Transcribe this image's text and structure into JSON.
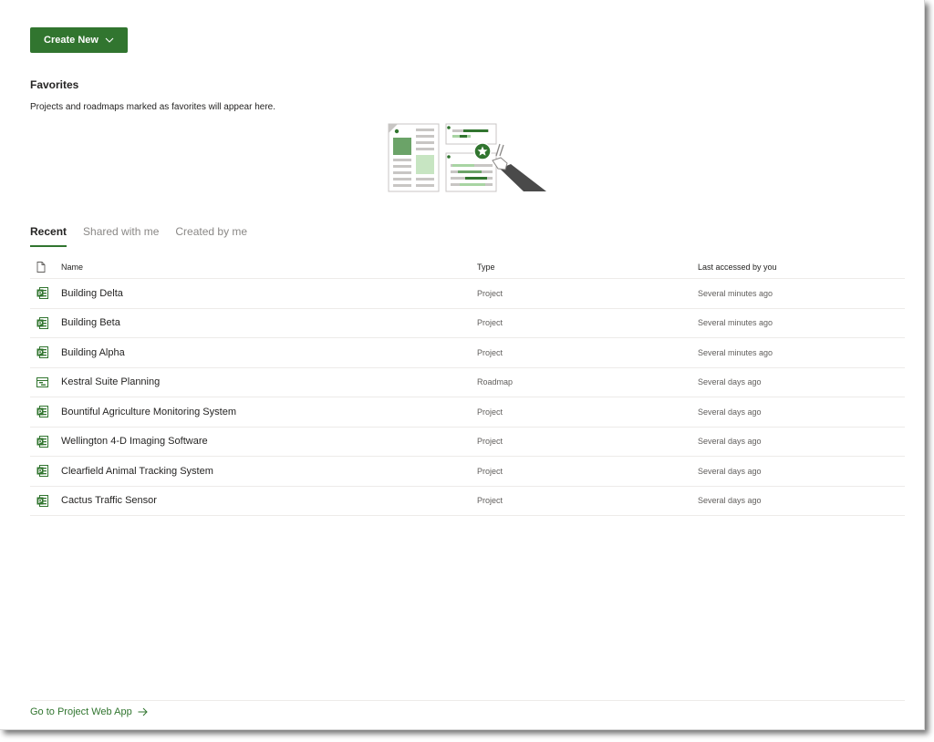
{
  "toolbar": {
    "create_new_label": "Create New"
  },
  "favorites": {
    "title": "Favorites",
    "description": "Projects and roadmaps marked as favorites will appear here."
  },
  "tabs": [
    {
      "label": "Recent",
      "active": true
    },
    {
      "label": "Shared with me",
      "active": false
    },
    {
      "label": "Created by me",
      "active": false
    }
  ],
  "table": {
    "headers": {
      "name": "Name",
      "type": "Type",
      "last_accessed": "Last accessed by you"
    },
    "rows": [
      {
        "icon": "project-icon",
        "name": "Building Delta",
        "type": "Project",
        "last_accessed": "Several minutes ago"
      },
      {
        "icon": "project-icon",
        "name": "Building Beta",
        "type": "Project",
        "last_accessed": "Several minutes ago"
      },
      {
        "icon": "project-icon",
        "name": "Building Alpha",
        "type": "Project",
        "last_accessed": "Several minutes ago"
      },
      {
        "icon": "roadmap-icon",
        "name": "Kestral Suite Planning",
        "type": "Roadmap",
        "last_accessed": "Several days ago"
      },
      {
        "icon": "project-icon",
        "name": "Bountiful Agriculture Monitoring System",
        "type": "Project",
        "last_accessed": "Several days ago"
      },
      {
        "icon": "project-icon",
        "name": "Wellington 4-D Imaging Software",
        "type": "Project",
        "last_accessed": "Several days ago"
      },
      {
        "icon": "project-icon",
        "name": "Clearfield Animal Tracking System",
        "type": "Project",
        "last_accessed": "Several days ago"
      },
      {
        "icon": "project-icon",
        "name": "Cactus Traffic Sensor",
        "type": "Project",
        "last_accessed": "Several days ago"
      }
    ]
  },
  "footer": {
    "link_label": "Go to Project Web App"
  },
  "colors": {
    "accent": "#31752f",
    "text": "#252423",
    "muted": "#605e5c",
    "divider": "#edebe9"
  }
}
